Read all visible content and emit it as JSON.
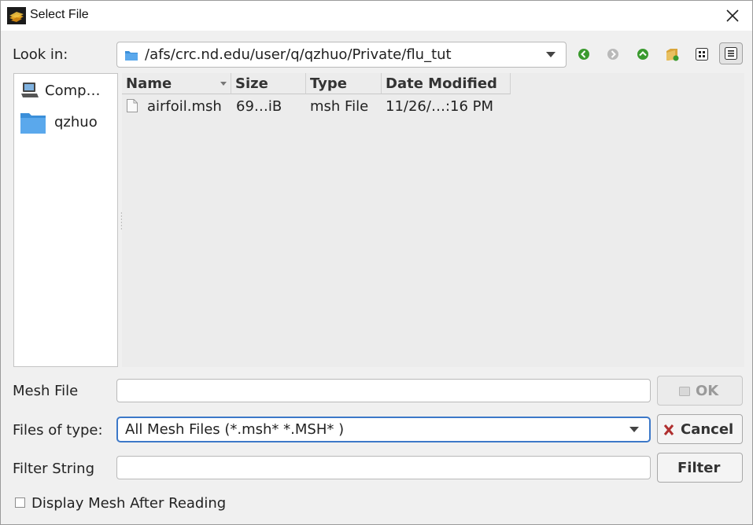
{
  "window": {
    "title": "Select File"
  },
  "toolbar": {
    "look_in_label": "Look in:",
    "path": "/afs/crc.nd.edu/user/q/qzhuo/Private/flu_tut",
    "icons": [
      "back-icon",
      "forward-icon",
      "parent-dir-icon",
      "new-folder-icon",
      "list-view-icon",
      "detail-view-icon"
    ]
  },
  "sidebar": {
    "items": [
      {
        "label": "Comp…",
        "icon": "computer-icon"
      },
      {
        "label": "qzhuo",
        "icon": "folder-icon"
      }
    ]
  },
  "file_list": {
    "columns": [
      "Name",
      "Size",
      "Type",
      "Date Modified"
    ],
    "rows": [
      {
        "name": "airfoil.msh",
        "size": "69…iB",
        "type": "msh File",
        "date": "11/26/…:16 PM"
      }
    ]
  },
  "form": {
    "mesh_file_label": "Mesh File",
    "mesh_file_value": "",
    "files_of_type_label": "Files of type:",
    "files_of_type_value": "All Mesh Files (*.msh* *.MSH* )",
    "filter_string_label": "Filter String",
    "filter_string_value": "",
    "display_mesh_label": "Display Mesh After Reading",
    "display_mesh_checked": false
  },
  "buttons": {
    "ok": "OK",
    "cancel": "Cancel",
    "filter": "Filter"
  },
  "colors": {
    "accent_green": "#3a9a2e",
    "cancel_red": "#b03030",
    "folder_blue": "#3b8fd9"
  }
}
